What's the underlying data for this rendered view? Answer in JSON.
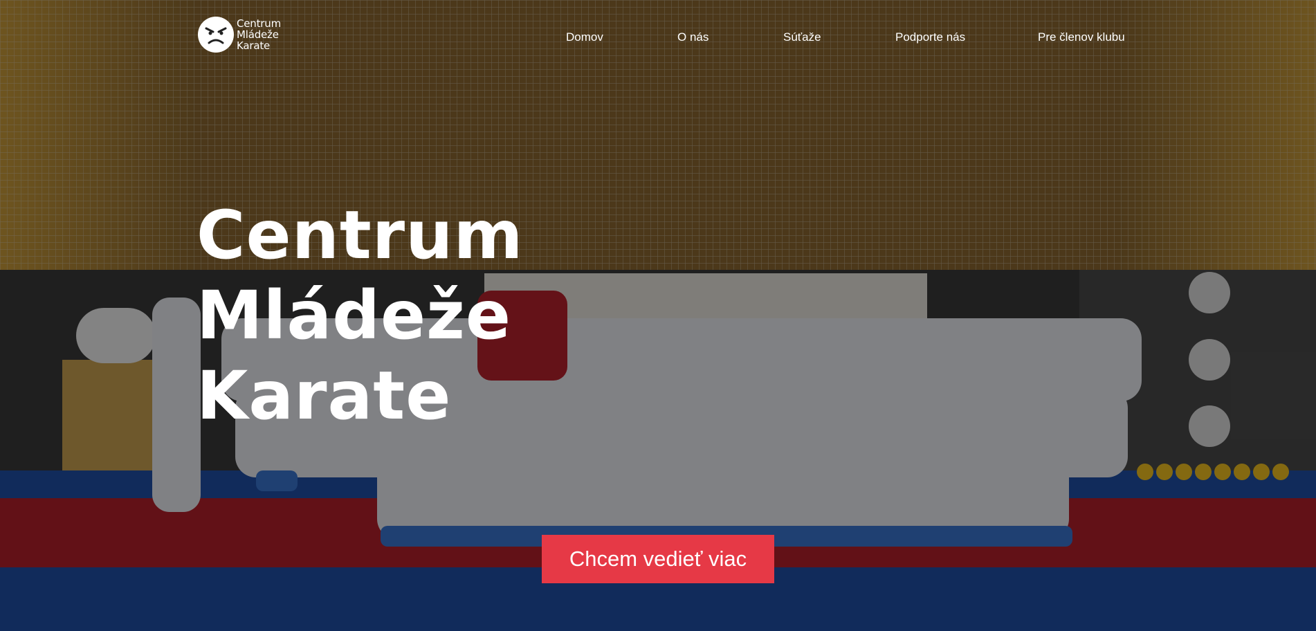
{
  "logo": {
    "line1": "Centrum",
    "line2": "Mládeže",
    "line3": "Karate",
    "icon": "angry-face-icon"
  },
  "nav": {
    "items": [
      "Domov",
      "O nás",
      "Súťaže",
      "Podporte nás",
      "Pre členov klubu"
    ]
  },
  "hero": {
    "title_line1": "Centrum",
    "title_line2": "Mládeže",
    "title_line3": "Karate",
    "background": "group-photo-karate-team"
  },
  "cta": {
    "label": "Chcem vedieť viac"
  },
  "colors": {
    "accent": "#e63946",
    "text": "#ffffff",
    "mat_red": "#b3202b",
    "mat_blue": "#1f4fa6"
  }
}
